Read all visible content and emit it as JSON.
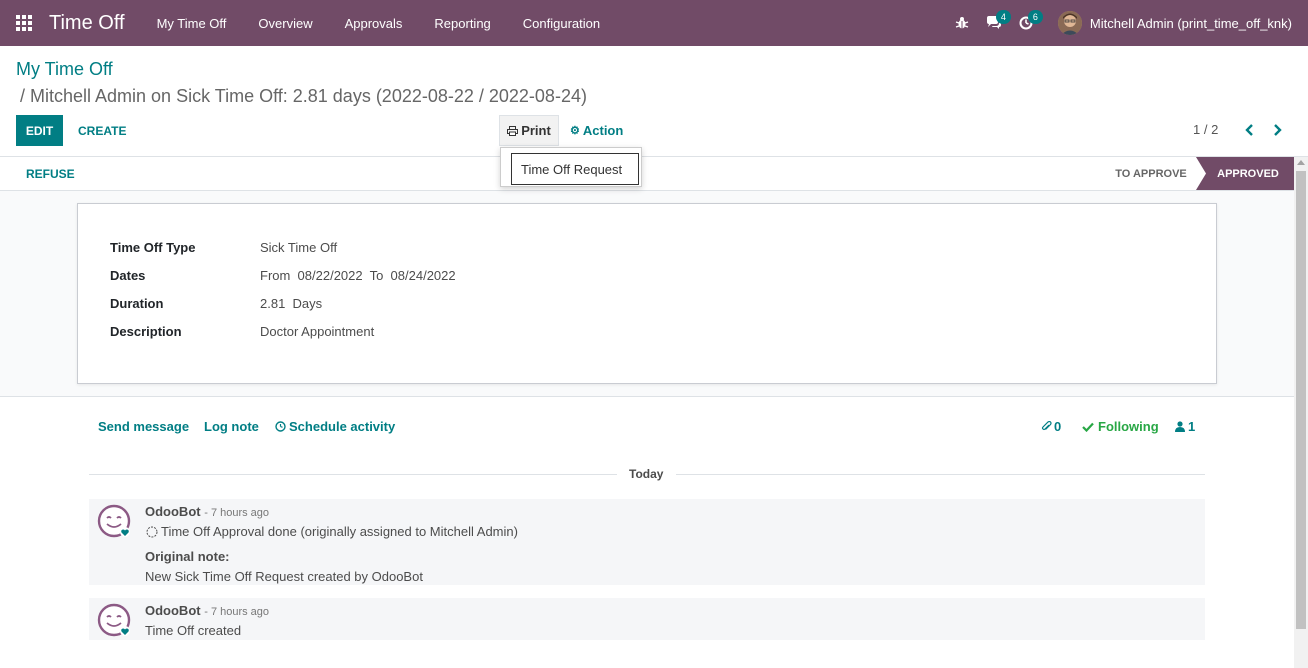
{
  "navbar": {
    "app_title": "Time Off",
    "menu": [
      "My Time Off",
      "Overview",
      "Approvals",
      "Reporting",
      "Configuration"
    ],
    "messages_count": "4",
    "activities_count": "6",
    "user_name": "Mitchell Admin (print_time_off_knk)"
  },
  "breadcrumb": {
    "parent": "My Time Off",
    "current": "/ Mitchell Admin on Sick Time Off: 2.81 days (2022-08-22 / 2022-08-24)"
  },
  "toolbar": {
    "edit_label": "EDIT",
    "create_label": "CREATE",
    "print_label": "Print",
    "action_label": "Action",
    "pager": "1 / 2"
  },
  "print_menu": {
    "items": [
      "Time Off Request"
    ]
  },
  "statusbar": {
    "refuse_label": "REFUSE",
    "stages": [
      "TO APPROVE",
      "APPROVED"
    ],
    "active_stage": "APPROVED"
  },
  "form": {
    "fields": [
      {
        "label": "Time Off Type",
        "value": "Sick Time Off"
      },
      {
        "label": "Dates",
        "value": "From  08/22/2022  To  08/24/2022"
      },
      {
        "label": "Duration",
        "value": "2.81  Days"
      },
      {
        "label": "Description",
        "value": "Doctor Appointment"
      }
    ]
  },
  "chatter": {
    "send_message": "Send message",
    "log_note": "Log note",
    "schedule_activity": "Schedule activity",
    "attachments_count": "0",
    "following_label": "Following",
    "followers_count": "1",
    "date_separator": "Today",
    "messages": [
      {
        "author": "OdooBot",
        "time": "- 7 hours ago",
        "body": "Time Off Approval done (originally assigned to Mitchell Admin)",
        "note_label": "Original note:",
        "note": "New Sick Time Off Request created by OdooBot"
      },
      {
        "author": "OdooBot",
        "time": "- 7 hours ago",
        "body": "Time Off created"
      }
    ]
  },
  "colors": {
    "brand": "#714B67",
    "accent": "#017e84",
    "following": "#28a745"
  }
}
